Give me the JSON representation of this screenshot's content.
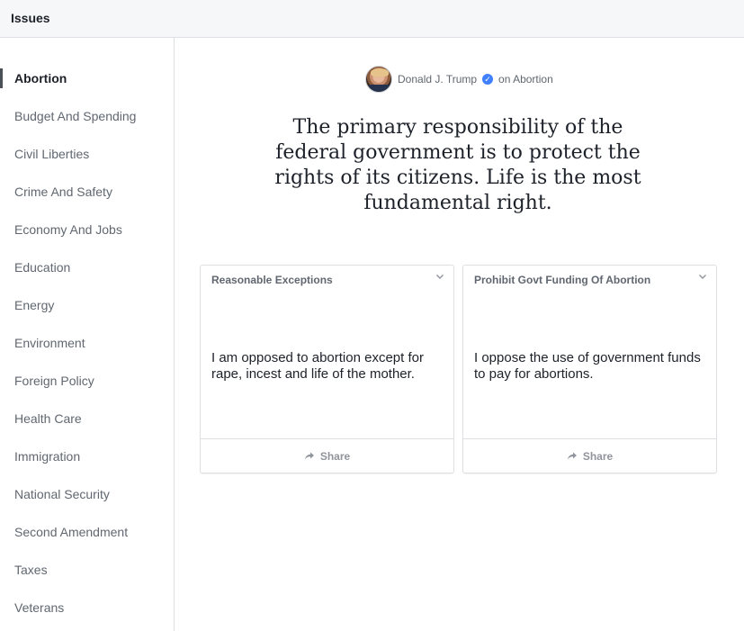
{
  "header": {
    "title": "Issues"
  },
  "sidebar": {
    "items": [
      {
        "label": "Abortion",
        "active": true
      },
      {
        "label": "Budget And Spending"
      },
      {
        "label": "Civil Liberties"
      },
      {
        "label": "Crime And Safety"
      },
      {
        "label": "Economy And Jobs"
      },
      {
        "label": "Education"
      },
      {
        "label": "Energy"
      },
      {
        "label": "Environment"
      },
      {
        "label": "Foreign Policy"
      },
      {
        "label": "Health Care"
      },
      {
        "label": "Immigration"
      },
      {
        "label": "National Security"
      },
      {
        "label": "Second Amendment"
      },
      {
        "label": "Taxes"
      },
      {
        "label": "Veterans"
      }
    ]
  },
  "main": {
    "byline": {
      "name": "Donald J. Trump",
      "topic": "on Abortion",
      "verified_icon": "verified-check-icon"
    },
    "quote": "The primary responsibility of the federal government is to protect the rights of its citizens. Life is the most fundamental right.",
    "cards": [
      {
        "title": "Reasonable Exceptions",
        "body": "I am opposed to abortion except for rape, incest and life of the mother.",
        "share_label": "Share"
      },
      {
        "title": "Prohibit Govt Funding Of Abortion",
        "body": "I oppose the use of government funds to pay for abortions.",
        "share_label": "Share"
      }
    ]
  },
  "colors": {
    "verified": "#4080ff",
    "active_indicator": "#4b4f56",
    "border": "#dddfe2"
  }
}
